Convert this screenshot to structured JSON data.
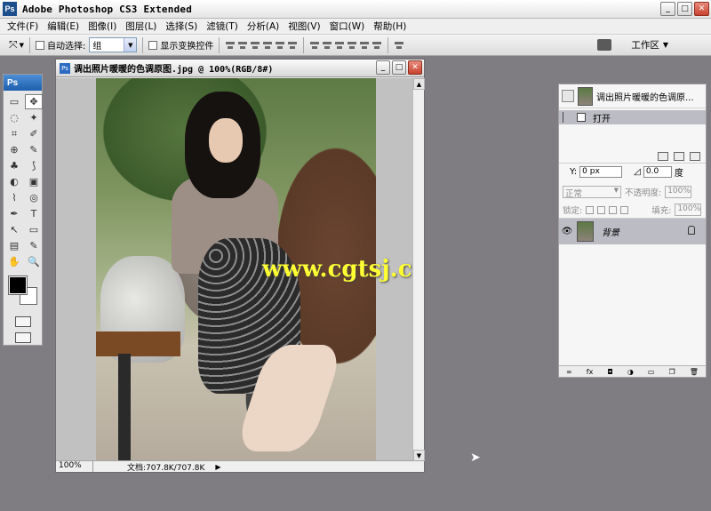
{
  "window": {
    "logo": "Ps",
    "title": "Adobe Photoshop CS3 Extended",
    "min": "_",
    "max": "□",
    "close": "✕"
  },
  "menu": [
    "文件(F)",
    "编辑(E)",
    "图像(I)",
    "图层(L)",
    "选择(S)",
    "滤镜(T)",
    "分析(A)",
    "视图(V)",
    "窗口(W)",
    "帮助(H)"
  ],
  "options": {
    "auto_select_label": "自动选择:",
    "auto_select_value": "组",
    "show_transform_label": "显示变换控件",
    "workspace_label": "工作区",
    "workspace_arrow": "▼"
  },
  "tools": {
    "header": "Ps",
    "items": [
      "▭",
      "✥",
      "◌",
      "✦",
      "⌗",
      "✐",
      "⊕",
      "✎",
      "♣",
      "⟆",
      "◐",
      "▣",
      "⌇",
      "◎",
      "✒",
      "T",
      "↖",
      "▭",
      "▤",
      "✎",
      "✋",
      "🔍"
    ]
  },
  "document": {
    "icon": "Ps",
    "title": "调出照片暖暖的色调原图.jpg @ 100%(RGB/8#)",
    "watermark": "www.cgtsj.com",
    "zoom": "100%",
    "doc_size": "文档:707.8K/707.8K",
    "status_arrow": "▶"
  },
  "history": {
    "snapshot_name": "调出照片暖暖的色调原...",
    "states": [
      {
        "label": "打开"
      }
    ]
  },
  "layers": {
    "y_label": "Y:",
    "y_value": "0 px",
    "angle_value": "0.0",
    "angle_unit": "度",
    "blend_mode": "正常",
    "opacity_label": "不透明度:",
    "opacity_value": "100%",
    "lock_label": "锁定:",
    "fill_label": "填充:",
    "fill_value": "100%",
    "layer_name": "背景"
  },
  "footer_icons": [
    "link-icon",
    "fx-icon",
    "mask-icon",
    "adjustment-icon",
    "folder-icon",
    "new-layer-icon",
    "trash-icon"
  ]
}
